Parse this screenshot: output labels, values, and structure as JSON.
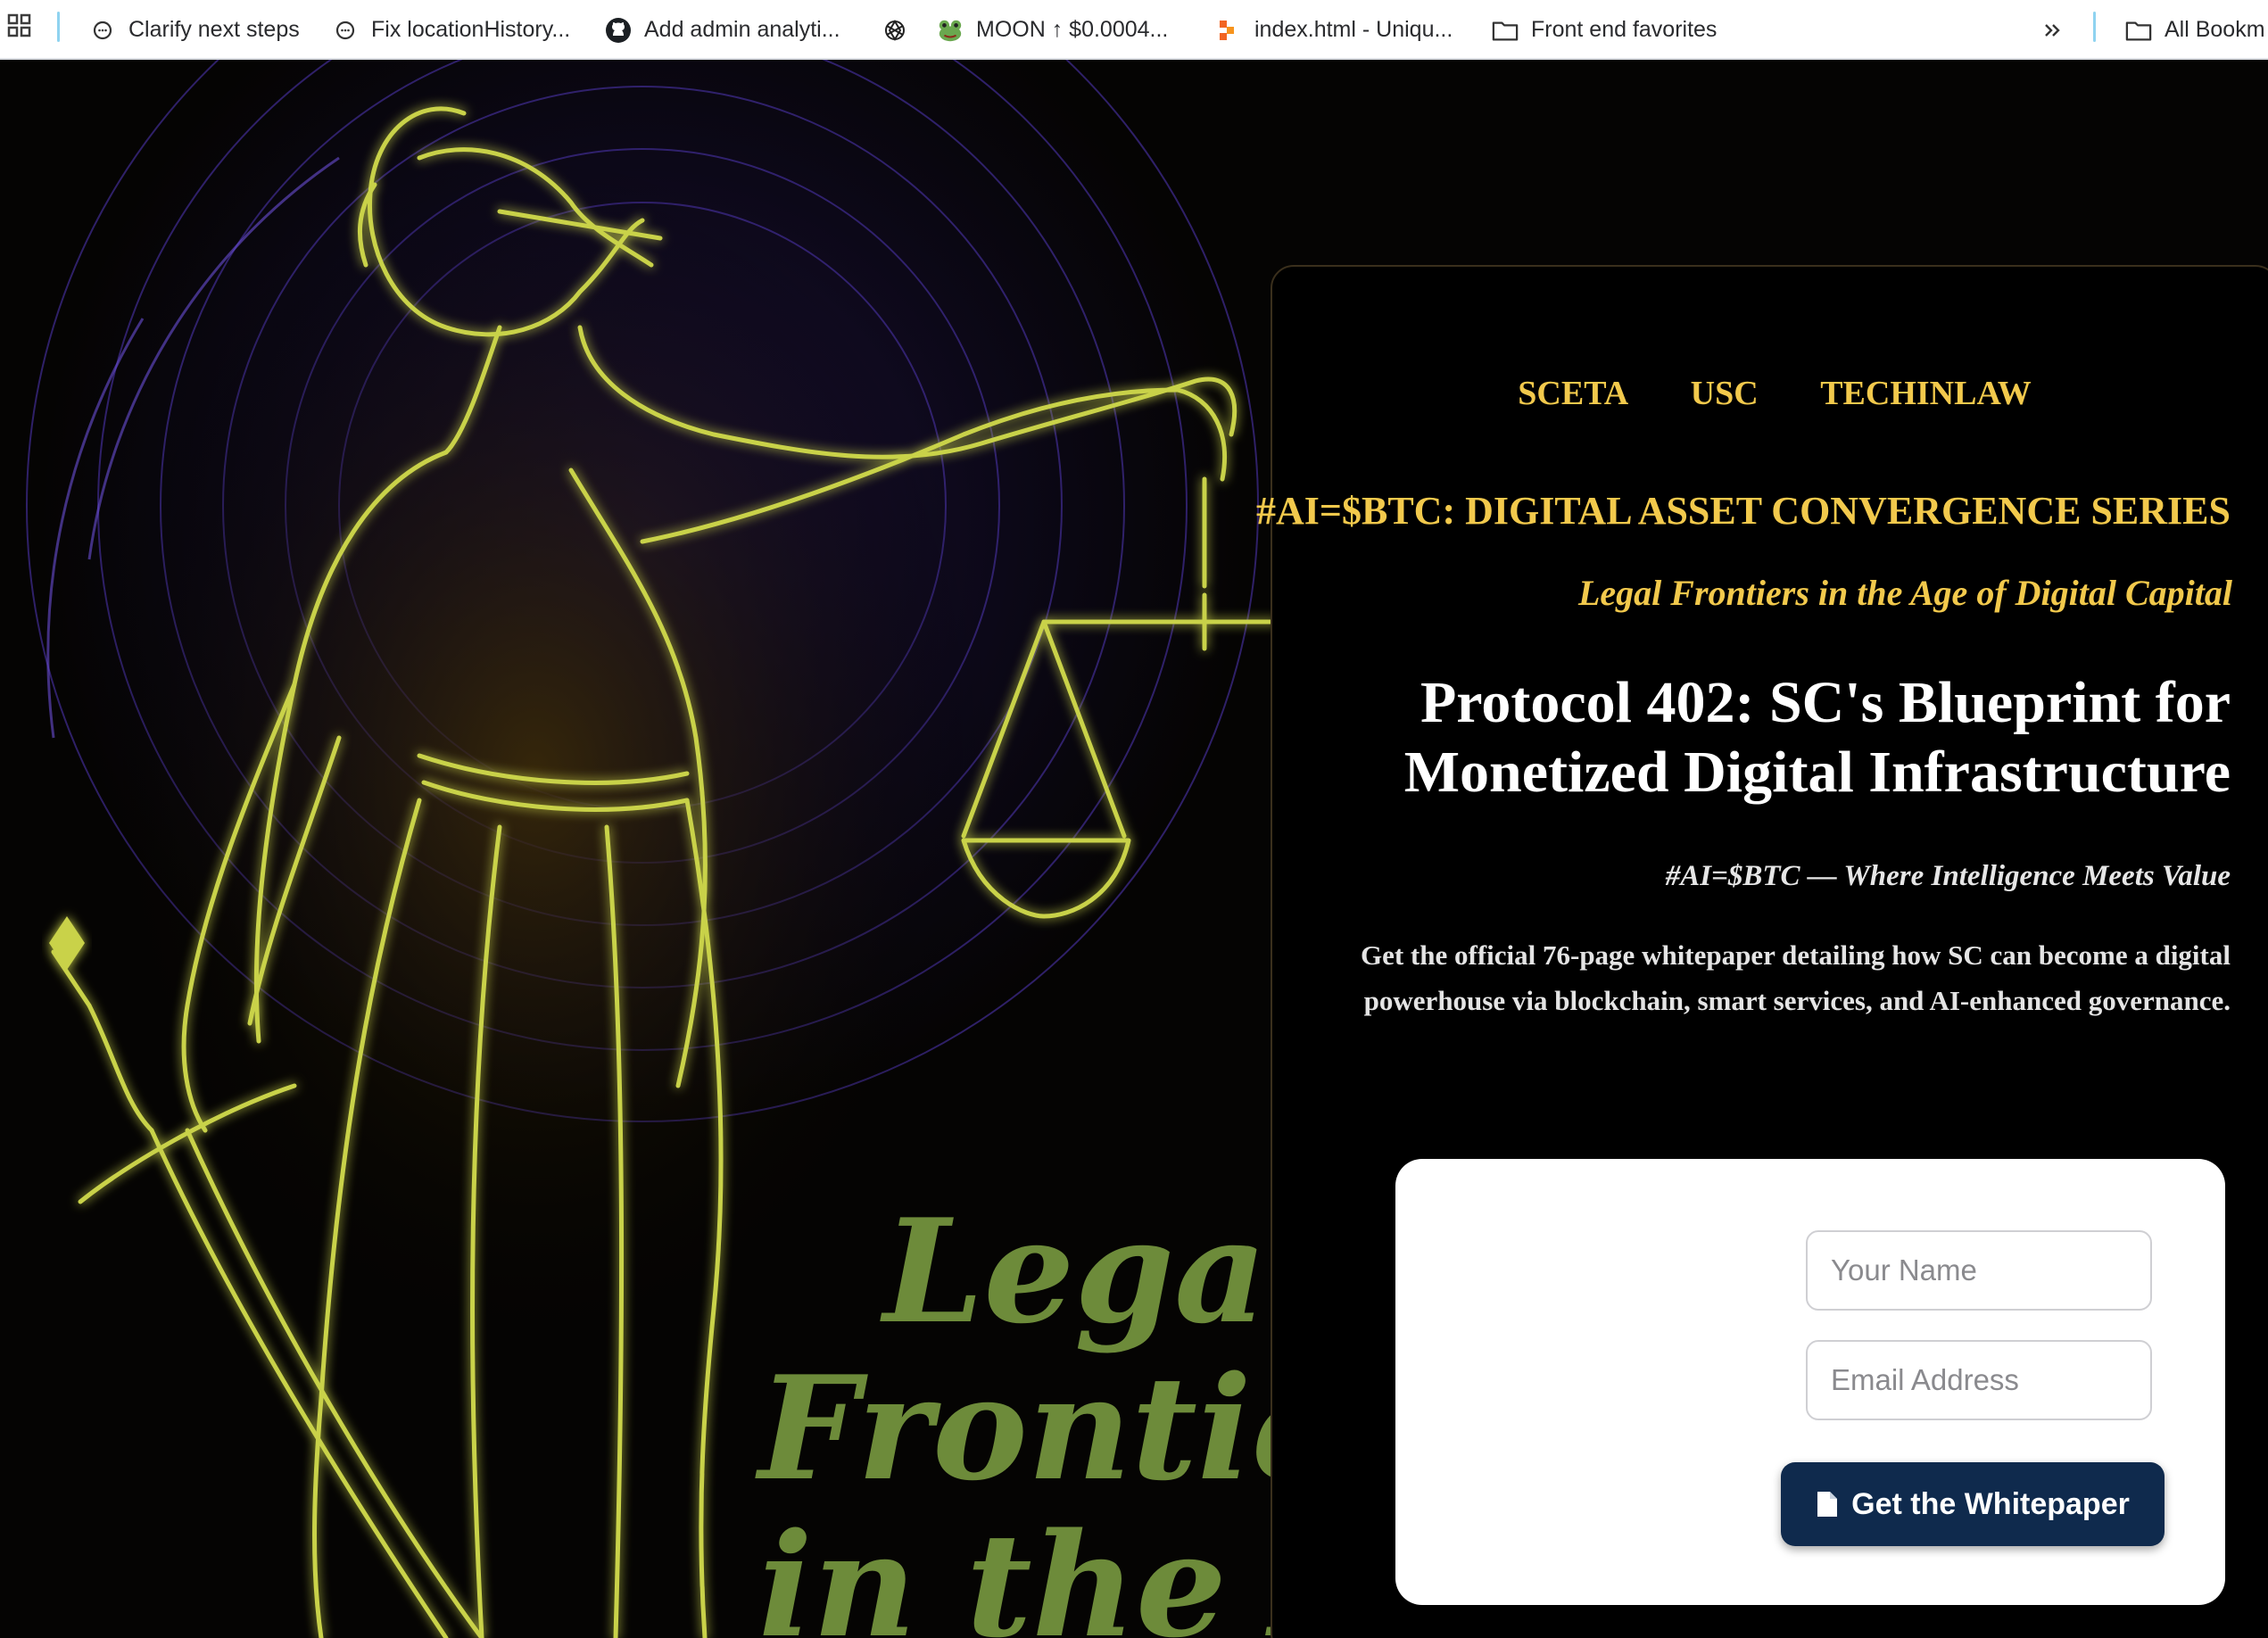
{
  "bookmarks_bar": {
    "items": [
      {
        "label": "Clarify next steps",
        "icon": "chat-bubble-icon"
      },
      {
        "label": "Fix locationHistory...",
        "icon": "chat-bubble-icon"
      },
      {
        "label": "Add admin analyti...",
        "icon": "github-icon"
      },
      {
        "label": "",
        "icon": "openai-icon"
      },
      {
        "label": "MOON ↑ $0.0004...",
        "icon": "frog-icon"
      },
      {
        "label": "index.html - Uniqu...",
        "icon": "code-file-icon"
      },
      {
        "label": "Front end favorites",
        "icon": "folder-icon"
      }
    ],
    "more_icon": "chevron-double-right-icon",
    "all_bookmarks": "All Bookm"
  },
  "hero": {
    "overlay_lines": [
      "Legal",
      "Frontier",
      "in the Ag"
    ]
  },
  "panel": {
    "nav": [
      "SCETA",
      "USC",
      "TECHINLAW"
    ],
    "series_title": "#AI=$BTC: DIGITAL ASSET CONVERGENCE SERIES",
    "subtitle": "Legal Frontiers in the Age of Digital Capital",
    "headline_line1": "Protocol 402: SC's Blueprint for",
    "headline_line2": "Monetized Digital Infrastructure",
    "tagline": "#AI=$BTC — Where Intelligence Meets Value",
    "description": "Get the official 76-page whitepaper detailing how SC can become a digital powerhouse via blockchain, smart services, and AI-enhanced governance.",
    "form": {
      "name_placeholder": "Your Name",
      "email_placeholder": "Email Address",
      "submit_label": "Get the Whitepaper"
    }
  },
  "colors": {
    "accent_gold": "#f2c94c",
    "button_navy": "#0f2a4d",
    "overlay_green": "#6d8b3a"
  }
}
